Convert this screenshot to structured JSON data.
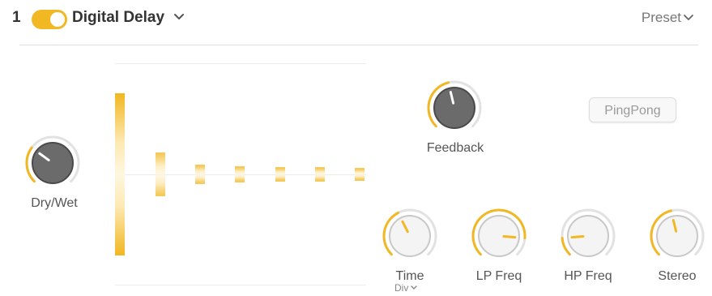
{
  "header": {
    "slot_number": "1",
    "enabled": true,
    "effect_name": "Digital Delay",
    "preset_label": "Preset"
  },
  "colors": {
    "accent": "#f2b824",
    "knob_dark": "#6b6b6b",
    "knob_light": "#f4f4f4",
    "ring": "#e2e2e2"
  },
  "knobs": {
    "dry_wet": {
      "label": "Dry/Wet",
      "value": 0.3
    },
    "feedback": {
      "label": "Feedback",
      "value": 0.45
    },
    "time": {
      "label": "Time",
      "sub_label": "Div",
      "value": 0.4
    },
    "lp_freq": {
      "label": "LP Freq",
      "value": 0.85
    },
    "hp_freq": {
      "label": "HP Freq",
      "value": 0.15
    },
    "stereo": {
      "label": "Stereo",
      "value": 0.45
    }
  },
  "buttons": {
    "pingpong": "PingPong"
  },
  "delay_taps": [
    1.0,
    0.27,
    0.12,
    0.1,
    0.09,
    0.09,
    0.08
  ]
}
